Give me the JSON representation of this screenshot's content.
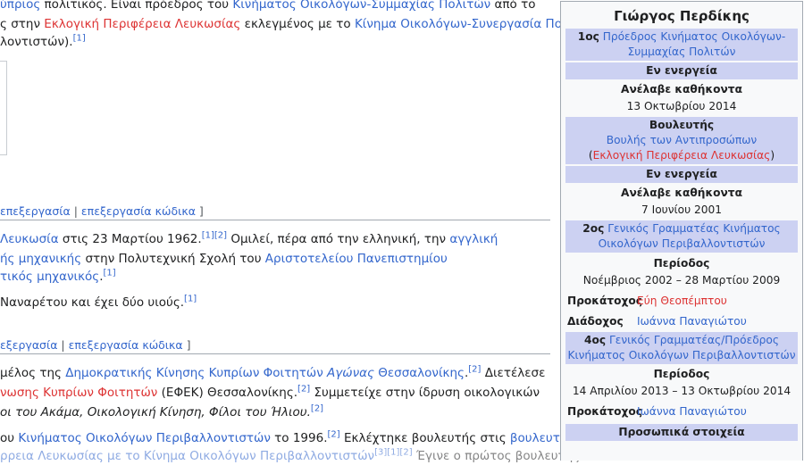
{
  "article": {
    "l1": {
      "a": "ύπριος",
      "b": " πολιτικός. Είναι πρόεδρος του ",
      "c": "Κινήματος Οικολόγων-Συμμαχίας Πολιτών",
      "d": " από το"
    },
    "l2": {
      "a": "ς στην ",
      "b": "Εκλογική Περιφέρεια Λευκωσίας",
      "c": " εκλεγμένος με το ",
      "d": "Κίνημα Οικολόγων-Συνεργασία Πολιτών"
    },
    "l3": {
      "a": "λοντιστών).",
      "r": "[1]"
    },
    "edit1": {
      "a": "επεξεργασία",
      "sep": " | ",
      "b": "επεξεργασία κώδικα",
      "end": " ]"
    },
    "l4": {
      "a": "Λευκωσία",
      "b": " στις 23 Μαρτίου 1962.",
      "r1": "[1]",
      "r2": "[2]",
      "c": " Ομιλεί, πέρα από την ελληνική, την ",
      "d": "αγγλική"
    },
    "l5": {
      "a": "ής μηχανικής",
      "b": " στην Πολυτεχνική Σχολή του ",
      "c": "Αριστοτελείου Πανεπιστημίου"
    },
    "l6": {
      "a": "τικός μηχανικός",
      "b": ".",
      "r": "[1]"
    },
    "l7": {
      "a": "Ναναρέτου και έχει δύο υιούς.",
      "r": "[1]"
    },
    "edit2": {
      "a": "εξεργασία",
      "sep": " | ",
      "b": "επεξεργασία κώδικα",
      "end": " ]"
    },
    "l8": {
      "a": "μέλος της ",
      "b": "Δημοκρατικής Κίνησης Κυπρίων Φοιτητών",
      "c": " Αγώνας",
      "d": " Θεσσαλονίκης",
      "e": ".",
      "r": "[2]",
      "f": " Διετέλεσε"
    },
    "l9": {
      "a": "νωσης Κυπρίων Φοιτητών",
      "b": " (ΕΦΕΚ) Θεσσαλονίκης.",
      "r": "[2]",
      "c": " Συμμετείχε στην ίδρυση οικολογικών"
    },
    "l10": {
      "a": "οι του Ακάμα, Οικολογική Κίνηση, Φίλοι του Ήλιου.",
      "r": "[2]"
    },
    "l11": {
      "a": "ου ",
      "b": "Κινήματος Οικολόγων Περιβαλλοντιστών",
      "c": " το 1996.",
      "r": "[2]",
      "d": " Εκλέχτηκε βουλευτής στις ",
      "e": "βουλευτικές"
    },
    "l12": {
      "a": "ρρεια Λευκωσίας με το Κίνημα Οικολόγων Περιβαλλοντιστών",
      "r": "[3][1][2]",
      "b": " Έγινε ο πρώτος βουλευτής"
    }
  },
  "infobox": {
    "title": "Γιώργος Περδίκης",
    "h1_ord": "1ος",
    "h1_link": "Πρόεδρος Κινήματος Οικολόγων-Συμμαχίας Πολιτών",
    "status1": "Εν ενεργεία",
    "took_label1": "Ανέλαβε καθήκοντα",
    "took_date1": "13 Οκτωβρίου 2014",
    "mp_label": "Βουλευτής",
    "mp_link": "Βουλής των Αντιπροσώπων",
    "mp_open": "(",
    "mp_constituency": "Εκλογική Περιφέρεια Λευκωσίας",
    "mp_close": ")",
    "status2": "Εν ενεργεία",
    "took_label2": "Ανέλαβε καθήκοντα",
    "took_date2": "7 Ιουνίου 2001",
    "h2_ord": "2ος",
    "h2_link": "Γενικός Γραμματέας Κινήματος Οικολόγων Περιβαλλοντιστών",
    "period_label1": "Περίοδος",
    "period1": "Νοέμβριος 2002 – 28 Μαρτίου 2009",
    "predecessor_label1": "Προκάτοχος",
    "predecessor1": "Εύη Θεοπέμπτου",
    "successor_label": "Διάδοχος",
    "successor": "Ιωάννα Παναγιώτου",
    "h3_ord": "4ος",
    "h3_link": "Γενικός Γραμματέας/Πρόεδρος Κινήματος Οικολόγων Περιβαλλοντιστών",
    "period_label2": "Περίοδος",
    "period2": "14 Απριλίου 2013 – 13 Οκτωβρίου 2014",
    "predecessor_label2": "Προκάτοχος",
    "predecessor2": "Ιωάννα Παναγιώτου",
    "personal_header": "Προσωπικά στοιχεία"
  }
}
